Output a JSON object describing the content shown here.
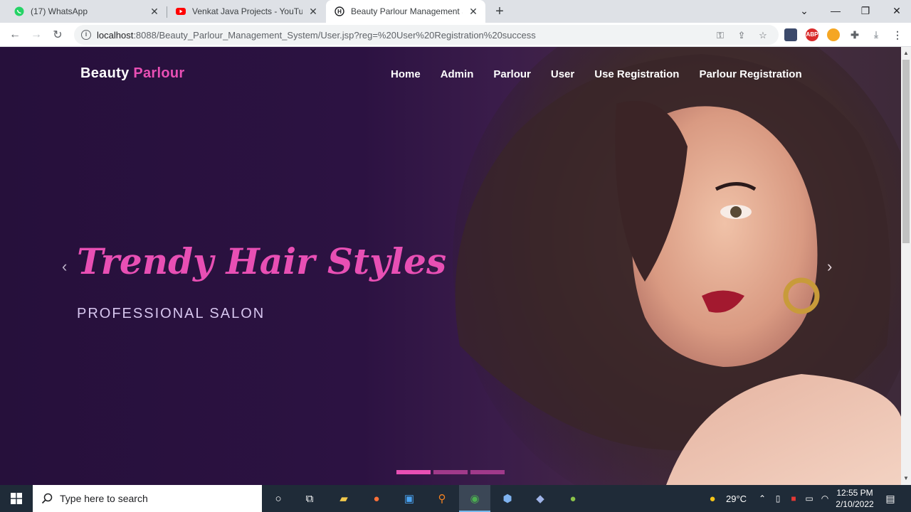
{
  "browser": {
    "tabs": [
      {
        "title": "(17) WhatsApp",
        "icon": "whatsapp-icon"
      },
      {
        "title": "Venkat Java Projects - YouTube",
        "icon": "youtube-icon"
      },
      {
        "title": "Beauty Parlour Management Syst",
        "icon": "h-site-icon",
        "active": true
      }
    ],
    "url": {
      "host": "localhost",
      "rest": ":8088/Beauty_Parlour_Management_System/User.jsp?reg=%20User%20Registration%20success"
    },
    "extensions": {
      "adblock": "ABP"
    }
  },
  "page": {
    "brand": {
      "primary": "Beauty",
      "accent": "Parlour"
    },
    "nav": [
      "Home",
      "Admin",
      "Parlour",
      "User",
      "Use Registration",
      "Parlour Registration"
    ],
    "hero": {
      "title": "Trendy Hair Styles",
      "subtitle": "PROFESSIONAL SALON",
      "slides_active_index": 0
    },
    "colors": {
      "accent": "#e84fb4",
      "background": "#2c1242"
    }
  },
  "taskbar": {
    "search_placeholder": "Type here to search",
    "weather": "29°C",
    "time": "12:55 PM",
    "date": "2/10/2022"
  }
}
